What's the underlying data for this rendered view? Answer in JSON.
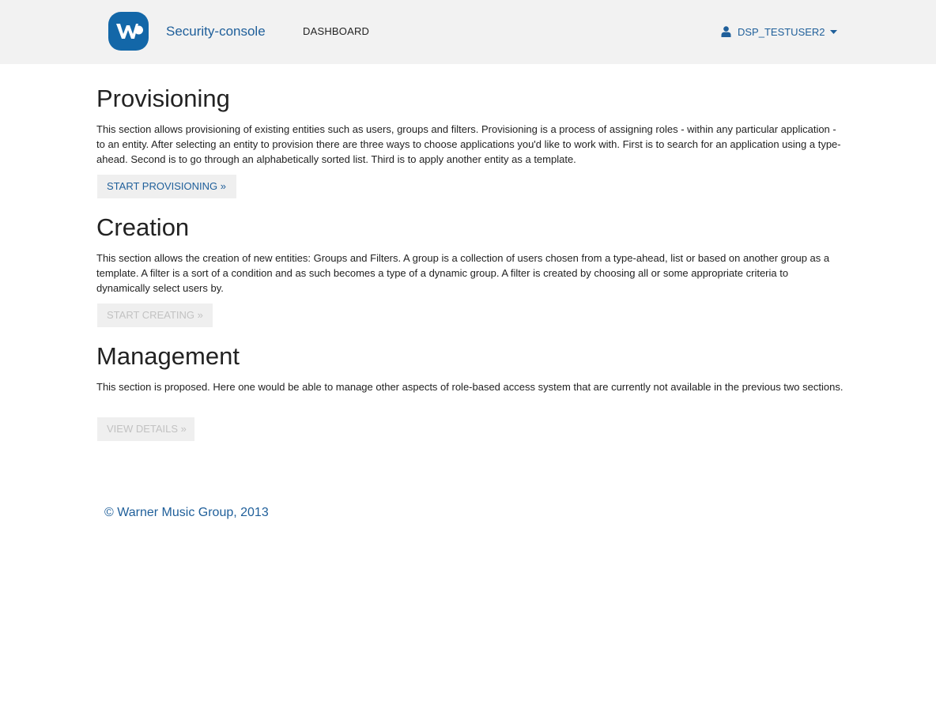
{
  "header": {
    "brand": "Security-console",
    "nav": [
      "DASHBOARD"
    ],
    "user": "DSP_TESTUSER2",
    "brand_color": "#1f5f9a",
    "background": "#f2f2f2"
  },
  "icons": {
    "logo": "warner-music-logo",
    "user": "user-icon",
    "caret": "caret-down-icon"
  },
  "sections": [
    {
      "title": "Provisioning",
      "text": "This section allows provisioning of existing entities such as users, groups and filters. Provisioning is a process of assigning roles - within any particular application - to an entity. After selecting an entity to provision there are three ways to choose applications you'd like to work with. First is to search for an application using a type-ahead. Second is to go through an alphabetically sorted list. Third is to apply another entity as a template.",
      "button": "START PROVISIONING »",
      "button_enabled": true
    },
    {
      "title": "Creation",
      "text": "This section allows the creation of new entities: Groups and Filters. A group is a collection of users chosen from a type-ahead, list or based on another group as a template. A filter is a sort of a condition and as such becomes a type of a dynamic group. A filter is created by choosing all or some appropriate criteria to dynamically select users by.",
      "button": "START CREATING »",
      "button_enabled": false
    },
    {
      "title": "Management",
      "text": "This section is proposed. Here one would be able to manage other aspects of role-based access system that are currently not available in the previous two sections.",
      "button": "VIEW DETAILS »",
      "button_enabled": false
    }
  ],
  "footer": {
    "text": "© Warner Music Group, 2013"
  }
}
